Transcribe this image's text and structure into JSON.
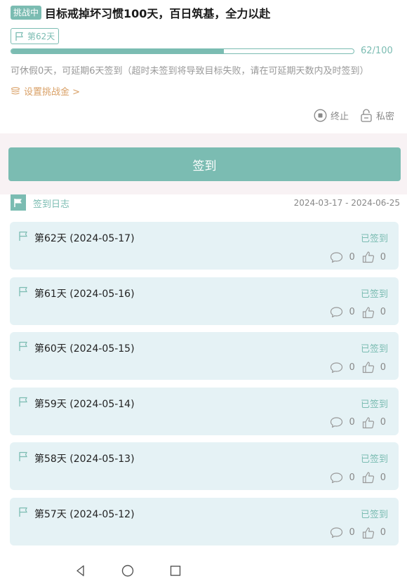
{
  "header": {
    "status_badge": "挑战中",
    "goal_title": "目标戒掉坏习惯100天，百日筑基，全力以赴",
    "day_tag": "第62天",
    "progress_text": "62/100",
    "progress_value": 62,
    "progress_max": 100,
    "hint": "可休假0天，可延期6天签到（超时未签到将导致目标失败，请在可延期天数内及时签到）",
    "deposit_link": "设置挑战金 >",
    "end_label": "终止",
    "private_label": "私密"
  },
  "checkin_button": "签到",
  "log": {
    "title": "签到日志",
    "range": "2024-03-17 - 2024-06-25",
    "items": [
      {
        "title": "第62天 (2024-05-17)",
        "status": "已签到",
        "comments": "0",
        "likes": "0"
      },
      {
        "title": "第61天 (2024-05-16)",
        "status": "已签到",
        "comments": "0",
        "likes": "0"
      },
      {
        "title": "第60天 (2024-05-15)",
        "status": "已签到",
        "comments": "0",
        "likes": "0"
      },
      {
        "title": "第59天 (2024-05-14)",
        "status": "已签到",
        "comments": "0",
        "likes": "0"
      },
      {
        "title": "第58天 (2024-05-13)",
        "status": "已签到",
        "comments": "0",
        "likes": "0"
      },
      {
        "title": "第57天 (2024-05-12)",
        "status": "已签到",
        "comments": "0",
        "likes": "0"
      }
    ]
  },
  "colors": {
    "accent": "#7bbcb2",
    "card_bg": "#e5f2f5",
    "band_bg": "#f8f2f4",
    "deposit": "#d9a066"
  },
  "icons": {
    "nav": [
      "back-icon",
      "home-icon",
      "recent-apps-icon"
    ]
  }
}
